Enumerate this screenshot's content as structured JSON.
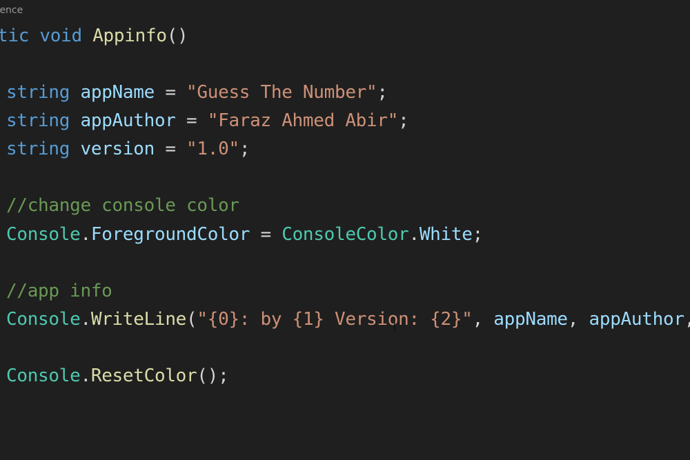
{
  "codelens": "rence",
  "lines": {
    "l1": {
      "kw1": "tic",
      "kw2": "void",
      "fn": "Appinfo",
      "punc": "()"
    },
    "l2": {
      "type": "string",
      "var": "appName",
      "op": " = ",
      "str": "\"Guess The Number\"",
      "end": ";"
    },
    "l3": {
      "type": "string",
      "var": "appAuthor",
      "op": " = ",
      "str": "\"Faraz Ahmed Abir\"",
      "end": ";"
    },
    "l4": {
      "type": "string",
      "var": "version",
      "op": " = ",
      "str": "\"1.0\"",
      "end": ";"
    },
    "l5": {
      "cmt": "//change console color"
    },
    "l6": {
      "cls": "Console",
      "dot": ".",
      "prop": "ForegroundColor",
      "op": " = ",
      "cls2": "ConsoleColor",
      "dot2": ".",
      "prop2": "White",
      "end": ";"
    },
    "l7": {
      "cmt": "//app info"
    },
    "l8": {
      "cls": "Console",
      "dot": ".",
      "fn": "WriteLine",
      "open": "(",
      "str": "\"{0}: by {1} Version: {2}\"",
      "sep": ", ",
      "v1": "appName",
      "sep2": ", ",
      "v2": "appAuthor",
      "sep3": ","
    },
    "l9": {
      "cls": "Console",
      "dot": ".",
      "fn": "ResetColor",
      "end": "();"
    }
  }
}
